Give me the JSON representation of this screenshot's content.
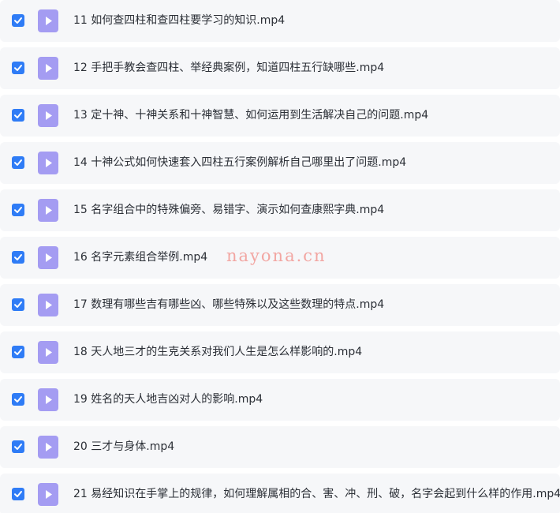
{
  "files": [
    {
      "name": "11 如何查四柱和查四柱要学习的知识.mp4",
      "checked": true,
      "icon": "video-file-icon"
    },
    {
      "name": "12 手把手教会查四柱、举经典案例，知道四柱五行缺哪些.mp4",
      "checked": true,
      "icon": "video-file-icon"
    },
    {
      "name": "13 定十神、十神关系和十神智慧、如何运用到生活解决自己的问题.mp4",
      "checked": true,
      "icon": "video-file-icon"
    },
    {
      "name": "14 十神公式如何快速套入四柱五行案例解析自己哪里出了问题.mp4",
      "checked": true,
      "icon": "video-file-icon"
    },
    {
      "name": "15 名字组合中的特殊偏旁、易错字、演示如何查康熙字典.mp4",
      "checked": true,
      "icon": "video-file-icon"
    },
    {
      "name": "16 名字元素组合举例.mp4",
      "checked": true,
      "icon": "video-file-icon"
    },
    {
      "name": "17 数理有哪些吉有哪些凶、哪些特殊以及这些数理的特点.mp4",
      "checked": true,
      "icon": "video-file-icon"
    },
    {
      "name": "18 天人地三才的生克关系对我们人生是怎么样影响的.mp4",
      "checked": true,
      "icon": "video-file-icon"
    },
    {
      "name": "19 姓名的天人地吉凶对人的影响.mp4",
      "checked": true,
      "icon": "video-file-icon"
    },
    {
      "name": "20 三才与身体.mp4",
      "checked": true,
      "icon": "video-file-icon"
    },
    {
      "name": "21 易经知识在手掌上的规律，如何理解属相的合、害、冲、刑、破，名字会起到什么样的作用.mp4",
      "checked": true,
      "icon": "video-file-icon"
    }
  ],
  "watermark": "nayona.cn",
  "colors": {
    "checkbox": "#2f7cf6",
    "icon_bg": "#a49cf2",
    "row_bg": "#f6f7f9",
    "text": "#2b2f36",
    "watermark": "#f2a6a2"
  }
}
